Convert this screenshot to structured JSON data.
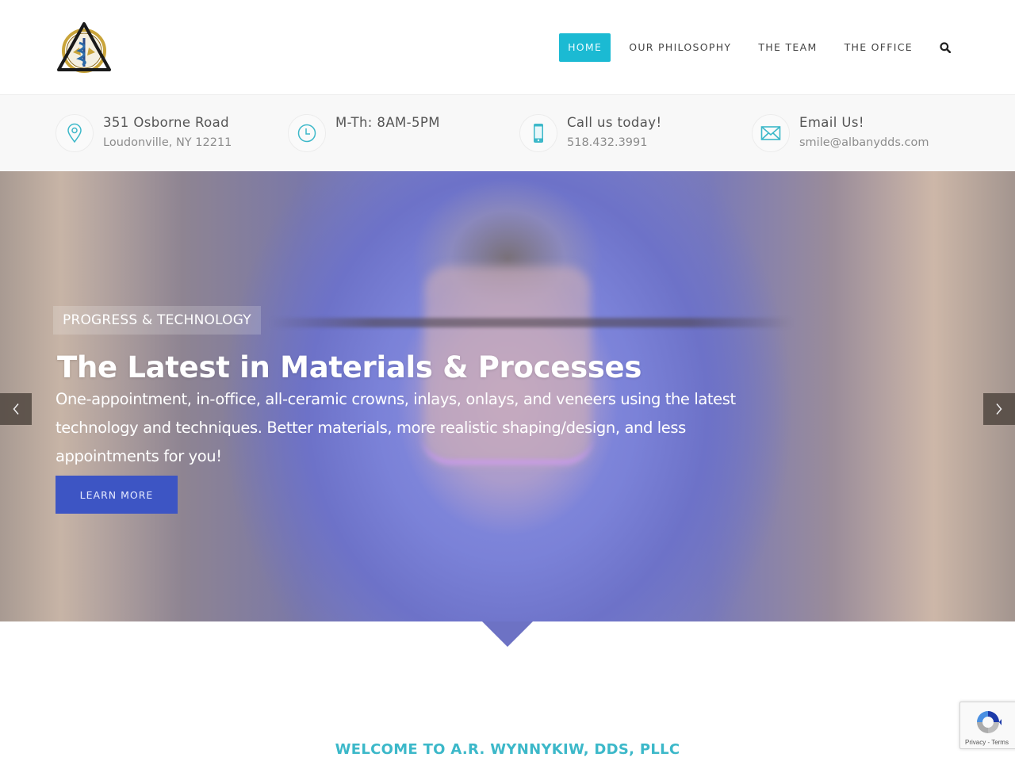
{
  "header": {
    "logo_alt": "Dental emblem logo",
    "nav": [
      {
        "label": "HOME",
        "active": true
      },
      {
        "label": "OUR PHILOSOPHY",
        "active": false
      },
      {
        "label": "THE TEAM",
        "active": false
      },
      {
        "label": "THE OFFICE",
        "active": false
      }
    ],
    "search_icon": "search-icon",
    "accent_color": "#1bbad3"
  },
  "infobar": [
    {
      "icon": "map-pin-icon",
      "title": "351 Osborne Road",
      "subtitle": "Loudonville, NY 12211"
    },
    {
      "icon": "clock-icon",
      "title": "M-Th: 8AM-5PM",
      "subtitle": ""
    },
    {
      "icon": "phone-icon",
      "title": "Call us today!",
      "subtitle": "518.432.3991"
    },
    {
      "icon": "envelope-icon",
      "title": "Email Us!",
      "subtitle": "smile@albanydds.com"
    }
  ],
  "hero": {
    "tag": "PROGRESS & TECHNOLOGY",
    "title": "The Latest in Materials & Processes",
    "description": "One-appointment, in-office, all-ceramic crowns, inlays, onlays, and veneers using the latest technology and techniques. Better materials, more realistic shaping/design, and less appointments for you!",
    "button_label": "LEARN MORE",
    "button_color": "#3d55c4",
    "prev_icon": "chevron-left-icon",
    "next_icon": "chevron-right-icon"
  },
  "welcome": {
    "heading": "WELCOME TO A.R. WYNNYKIW, DDS, PLLC",
    "color": "#3cb8c9"
  },
  "recaptcha": {
    "links": "Privacy - Terms"
  }
}
